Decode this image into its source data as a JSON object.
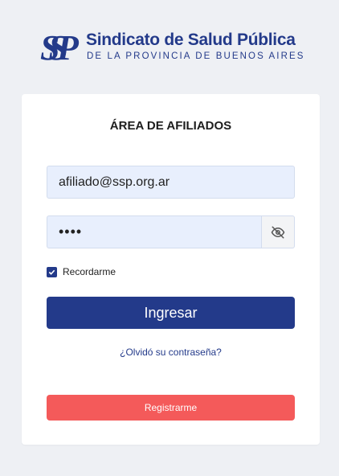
{
  "brand": {
    "name": "Sindicato de Salud Pública",
    "subtitle": "DE LA PROVINCIA DE BUENOS AIRES",
    "logo_text": "SSP",
    "color": "#233a8a"
  },
  "login_card": {
    "title": "ÁREA DE AFILIADOS",
    "email_value": "afiliado@ssp.org.ar",
    "password_mask": "••••",
    "toggle_password_icon": "eye-off-icon",
    "remember_label": "Recordarme",
    "remember_checked": true,
    "login_button": "Ingresar",
    "forgot_link": "¿Olvidó su contraseña?",
    "register_button": "Registrarme"
  },
  "colors": {
    "primary": "#233a8a",
    "register": "#f45a5a",
    "input_bg": "#e8effd",
    "page_bg": "#eef0f4"
  }
}
